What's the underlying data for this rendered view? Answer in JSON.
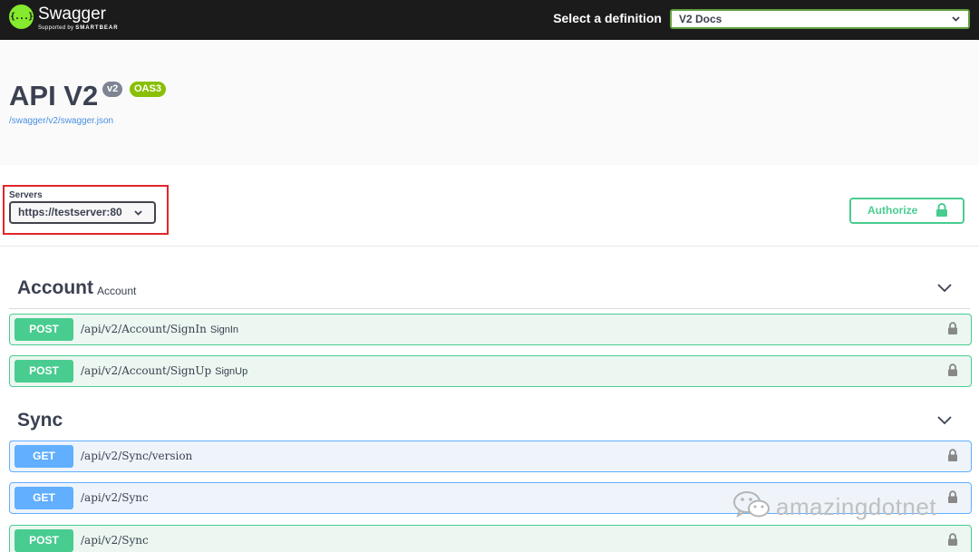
{
  "topbar": {
    "logo_title": "Swagger",
    "logo_sub_prefix": "Supported by",
    "logo_sub_brand": "SMARTBEAR",
    "logo_icon": "{...}",
    "definition_label": "Select a definition",
    "definition_value": "V2 Docs"
  },
  "info": {
    "title": "API V2",
    "version_badge": "v2",
    "oas_badge": "OAS3",
    "spec_url": "/swagger/v2/swagger.json"
  },
  "servers": {
    "label": "Servers",
    "selected": "https://testserver:80"
  },
  "authorize": {
    "label": "Authorize",
    "icon": "lock-icon"
  },
  "tags": [
    {
      "name": "Account",
      "description": "Account",
      "operations": [
        {
          "method": "POST",
          "path": "/api/v2/Account/SignIn",
          "summary": "SignIn"
        },
        {
          "method": "POST",
          "path": "/api/v2/Account/SignUp",
          "summary": "SignUp"
        }
      ]
    },
    {
      "name": "Sync",
      "description": "",
      "operations": [
        {
          "method": "GET",
          "path": "/api/v2/Sync/version",
          "summary": ""
        },
        {
          "method": "GET",
          "path": "/api/v2/Sync",
          "summary": ""
        },
        {
          "method": "POST",
          "path": "/api/v2/Sync",
          "summary": ""
        }
      ]
    }
  ],
  "watermark": {
    "text": "amazingdotnet",
    "icon": "wechat-icon"
  },
  "colors": {
    "topbar_bg": "#1b1b1b",
    "post": "#49cc90",
    "get": "#61affe",
    "oas_badge": "#89bf04",
    "highlight": "#e0262b"
  }
}
